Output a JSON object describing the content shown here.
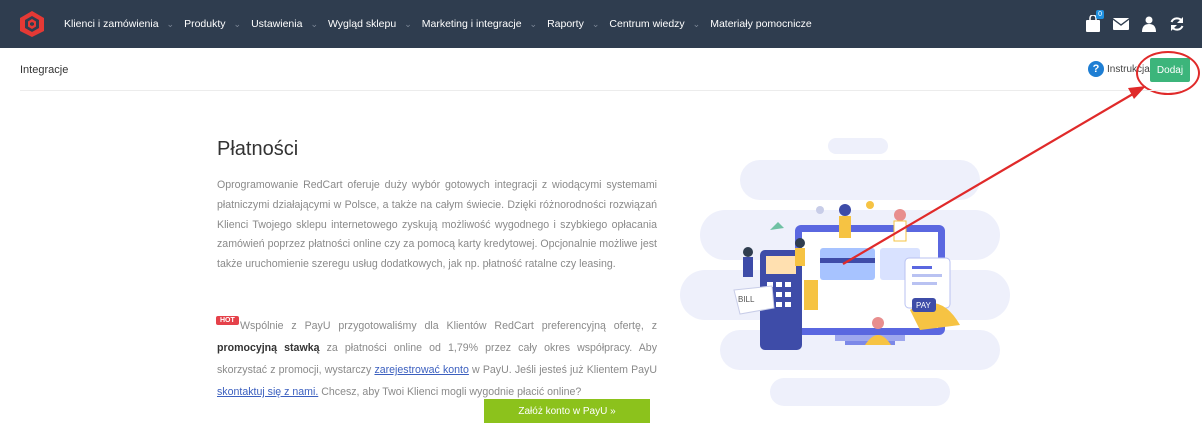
{
  "nav": {
    "items": [
      {
        "label": "Klienci i zamówienia",
        "has_chevron": true
      },
      {
        "label": "Produkty",
        "has_chevron": true
      },
      {
        "label": "Ustawienia",
        "has_chevron": true
      },
      {
        "label": "Wygląd sklepu",
        "has_chevron": true
      },
      {
        "label": "Marketing i integracje",
        "has_chevron": true
      },
      {
        "label": "Raporty",
        "has_chevron": true
      },
      {
        "label": "Centrum wiedzy",
        "has_chevron": true
      },
      {
        "label": "Materiały pomocnicze",
        "has_chevron": false
      }
    ],
    "cart_badge": "0",
    "icons": [
      "bag-icon",
      "mail-icon",
      "user-icon",
      "refresh-icon"
    ]
  },
  "header": {
    "title": "Integracje",
    "help_label": "Instrukcja",
    "add_button": "Dodaj"
  },
  "main": {
    "heading": "Płatności",
    "description": "Oprogramowanie RedCart oferuje duży wybór gotowych integracji z wiodącymi systemami płatniczymi działającymi w Polsce, a także na całym świecie. Dzięki różnorodności rozwiązań Klienci Twojego sklepu internetowego zyskują możliwość wygodnego i szybkiego opłacania zamówień poprzez płatności online czy za pomocą karty kredytowej. Opcjonalnie możliwe jest także uruchomienie szeregu usług dodatkowych, jak np. płatność ratalne czy leasing.",
    "hot_badge": "HOT",
    "promo_part1": "Wspólnie z PayU przygotowaliśmy dla Klientów RedCart preferencyjną ofertę, z ",
    "promo_bold": "promocyjną stawką",
    "promo_part2": " za płatności online od 1,79% przez cały okres współpracy. Aby skorzystać z promocji, wystarczy ",
    "promo_link1": "zarejestrować konto",
    "promo_part3": " w PayU. Jeśli jesteś już Klientem PayU ",
    "promo_link2": "skontaktuj się z nami.",
    "promo_part4": " Chcesz, aby Twoi Klienci mogli wygodnie płacić online?",
    "payu_button": "Załóż konto w PayU »",
    "illustration_labels": {
      "bill": "BILL",
      "pay": "PAY"
    }
  },
  "colors": {
    "topbar": "#2f3d4f",
    "accent_green": "#3cb57b",
    "payu_green": "#8cc21c",
    "annotation_red": "#e02a2a",
    "hot_red": "#e5414a"
  }
}
